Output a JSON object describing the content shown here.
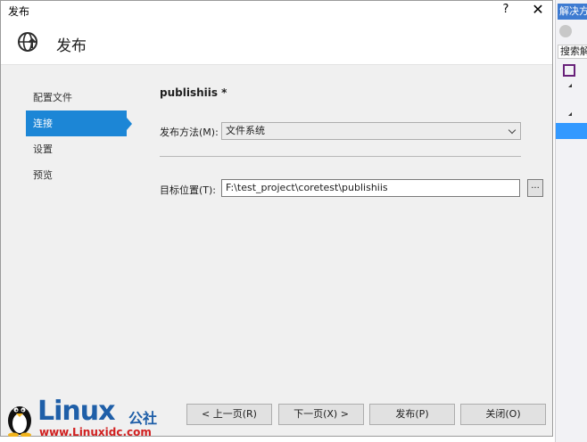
{
  "background": {
    "right_tab": "解决方",
    "right_search": "搜索解"
  },
  "window": {
    "title": "发布",
    "help": "?",
    "close": "✕"
  },
  "header": {
    "title": "发布",
    "icon": "globe-publish-icon"
  },
  "steps": [
    {
      "label": "配置文件",
      "active": false
    },
    {
      "label": "连接",
      "active": true
    },
    {
      "label": "设置",
      "active": false
    },
    {
      "label": "预览",
      "active": false
    }
  ],
  "profile_name": "publishiis *",
  "form": {
    "method_label": "发布方法(M):",
    "method_value": "文件系统",
    "target_label": "目标位置(T):",
    "target_value": "F:\\test_project\\coretest\\publishiis",
    "browse_label": "..."
  },
  "buttons": {
    "prev": "< 上一页(R)",
    "next": "下一页(X) >",
    "publish": "发布(P)",
    "close": "关闭(O)"
  },
  "watermark": {
    "brand": "Linux",
    "brand_cn": "公社",
    "url": "www.Linuxidc.com"
  },
  "colors": {
    "accent": "#1c86d6",
    "watermark_blue": "#1f5fa8",
    "watermark_red": "#d11f1f"
  }
}
